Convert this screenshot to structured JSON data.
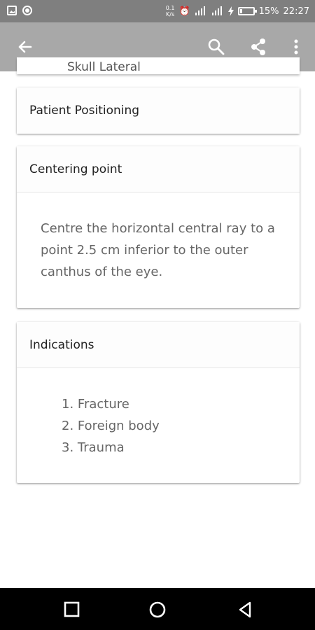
{
  "status_bar": {
    "net_speed_value": "0.1",
    "net_speed_unit": "K/s",
    "battery_percent_text": "15%",
    "battery_level": 0.15,
    "time": "22:27"
  },
  "app_bar": {
    "icons": [
      "back-arrow",
      "search",
      "share",
      "more-vert"
    ]
  },
  "page": {
    "title_peek": "Skull Lateral"
  },
  "sections": {
    "positioning": {
      "header": "Patient Positioning"
    },
    "centering": {
      "header": "Centering point",
      "body": "Centre the horizontal central ray to a point 2.5 cm inferior to the outer canthus of the eye."
    },
    "indications": {
      "header": "Indications",
      "items": [
        "1. Fracture",
        "2. Foreign body",
        "3. Trauma"
      ]
    }
  },
  "nav_bar": {
    "icons": [
      "recents-square",
      "home-circle",
      "back-triangle"
    ]
  },
  "colors": {
    "status_bar_bg": "#7f7f7f",
    "app_bar_bg": "#a8a8a8",
    "nav_bar_bg": "#000000"
  }
}
